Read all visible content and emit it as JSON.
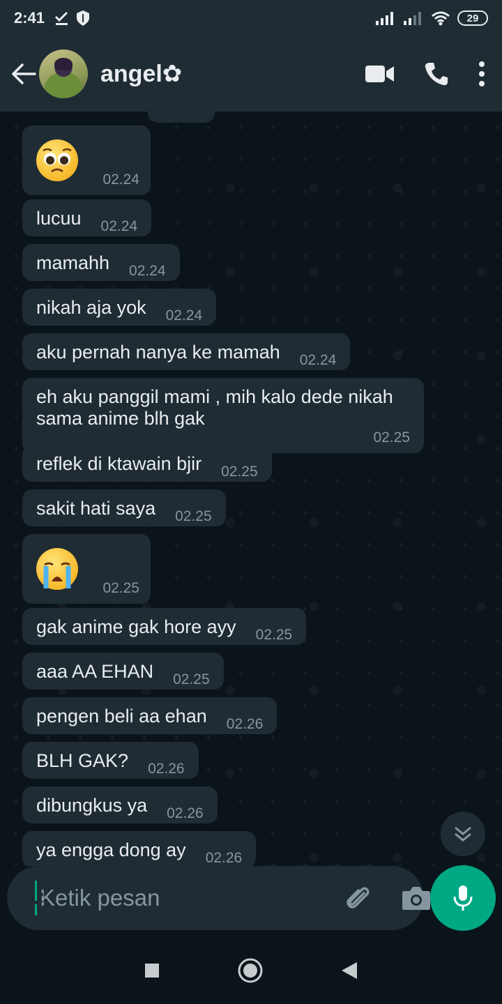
{
  "status_bar": {
    "time": "2:41",
    "battery": "29"
  },
  "header": {
    "contact_name": "angel✿"
  },
  "messages": [
    {
      "text": "",
      "time": "02.24",
      "emoji": "pleading-face"
    },
    {
      "text": "lucuu",
      "time": "02.24"
    },
    {
      "text": "mamahh",
      "time": "02.24"
    },
    {
      "text": "nikah aja yok",
      "time": "02.24"
    },
    {
      "text": "aku pernah nanya ke mamah",
      "time": "02.24"
    },
    {
      "text": "eh aku panggil mami , mih kalo dede nikah sama anime blh gak",
      "time": "02.25"
    },
    {
      "text": "reflek di ktawain bjir",
      "time": "02.25"
    },
    {
      "text": "sakit hati saya",
      "time": "02.25"
    },
    {
      "text": "",
      "time": "02.25",
      "emoji": "loudly-crying-face"
    },
    {
      "text": "gak anime gak hore ayy",
      "time": "02.25"
    },
    {
      "text": "aaa AA EHAN",
      "time": "02.25"
    },
    {
      "text": "pengen beli aa ehan",
      "time": "02.26"
    },
    {
      "text": "BLH GAK?",
      "time": "02.26"
    },
    {
      "text": "dibungkus ya",
      "time": "02.26"
    },
    {
      "text": "ya engga dong ay",
      "time": "02.26"
    }
  ],
  "composer": {
    "placeholder": "Ketik pesan"
  },
  "colors": {
    "accent": "#00a884",
    "bubble": "#1f2c34",
    "background": "#0b141a",
    "header": "#1f2c34"
  }
}
